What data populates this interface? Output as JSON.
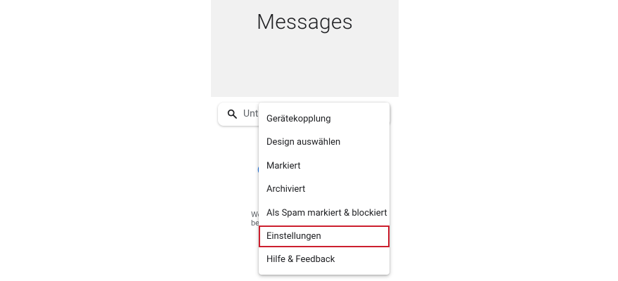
{
  "app": {
    "title": "Messages"
  },
  "search": {
    "placeholder_visible": "Unte"
  },
  "background": {
    "link_fragment": "(",
    "text_line1": "We",
    "text_line2": "be"
  },
  "menu": {
    "items": [
      {
        "label": "Gerätekopplung"
      },
      {
        "label": "Design auswählen"
      },
      {
        "label": "Markiert"
      },
      {
        "label": "Archiviert"
      },
      {
        "label": "Als Spam markiert & blockiert"
      },
      {
        "label": "Einstellungen"
      },
      {
        "label": "Hilfe & Feedback"
      }
    ],
    "highlighted_item": "Einstellungen"
  },
  "colors": {
    "header_bg": "#f1f1f1",
    "highlight_border": "#cc1f2e",
    "link": "#1a73e8"
  }
}
